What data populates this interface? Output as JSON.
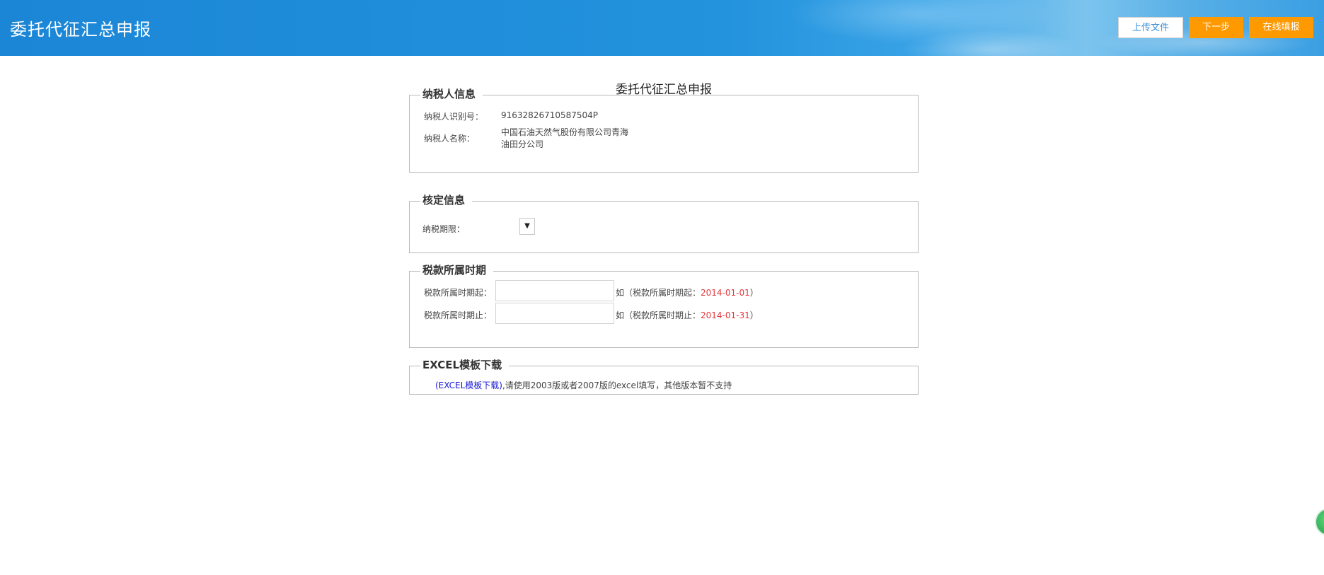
{
  "header": {
    "title": "委托代征汇总申报",
    "buttons": {
      "upload": "上传文件",
      "next": "下一步",
      "online": "在线填报"
    }
  },
  "form": {
    "title": "委托代征汇总申报"
  },
  "taxpayer": {
    "legend": "纳税人信息",
    "id_label": "纳税人识别号：",
    "id_value": "91632826710587504P",
    "name_label": "纳税人名称：",
    "name_line1": "中国石油天然气股份有限公司青海",
    "name_line2": "油田分公司"
  },
  "approval": {
    "legend": "核定信息",
    "period_label": "纳税期限：",
    "period_select_glyph": "▼"
  },
  "period": {
    "legend": "税款所属时期",
    "start_label": "税款所属时期起：",
    "start_value": "",
    "start_hint_prefix": "如（税款所属时期起：",
    "start_hint_date": "2014-01-01",
    "start_hint_suffix": "）",
    "end_label": "税款所属时期止：",
    "end_value": "",
    "end_hint_prefix": "如（税款所属时期止：",
    "end_hint_date": "2014-01-31",
    "end_hint_suffix": "）"
  },
  "excel": {
    "legend": "EXCEL模板下载",
    "link_text": "(EXCEL模板下载)",
    "note": ",请使用2003版或者2007版的excel填写，其他版本暂不支持"
  },
  "colors": {
    "header_blue": "#2393dd",
    "button_orange": "#ff9900",
    "hint_red": "#e4393c",
    "link_blue": "#1a1ad4"
  }
}
